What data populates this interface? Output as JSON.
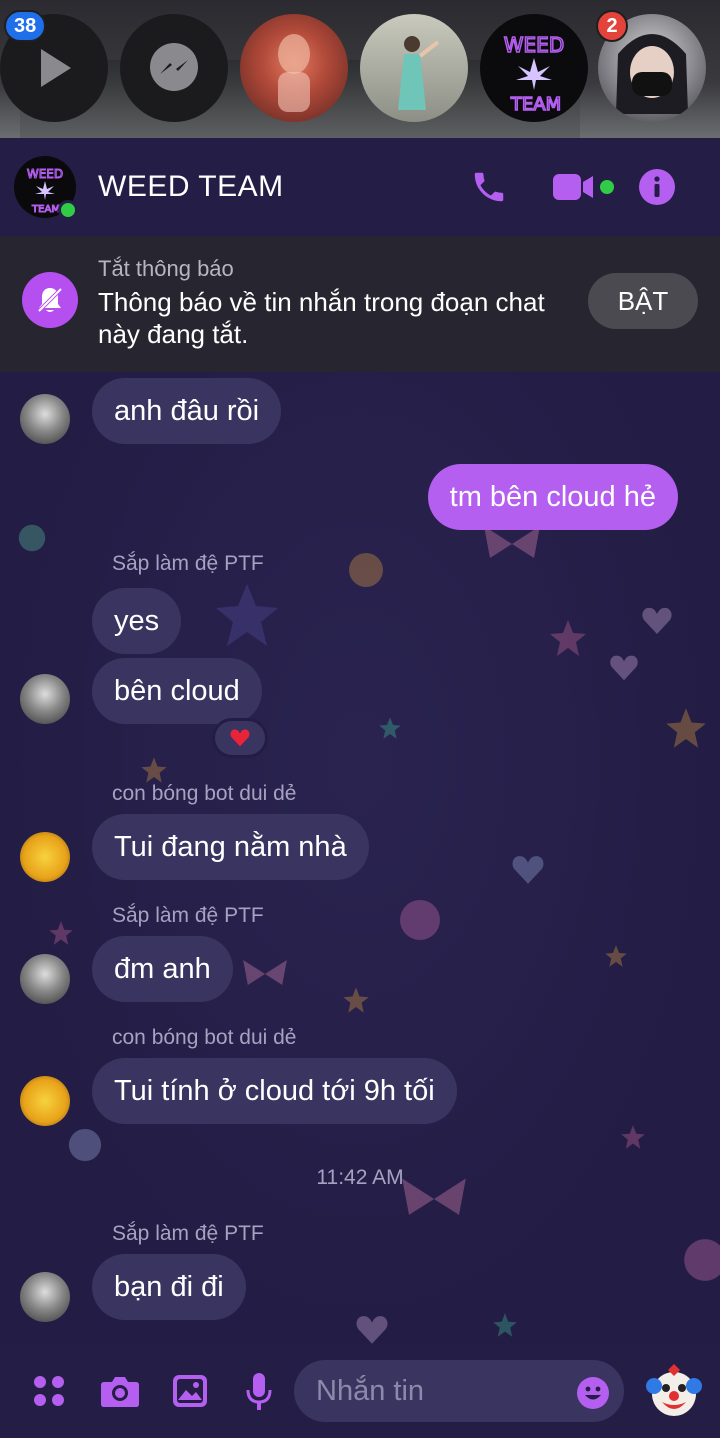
{
  "bubble_heads": {
    "badge_left": "38",
    "badge_right": "2"
  },
  "header": {
    "title": "WEED TEAM",
    "group_logo_text": "WEED TEAM"
  },
  "muted_banner": {
    "title": "Tắt thông báo",
    "text": "Thông báo về tin nhắn trong đoạn chat này đang tắt.",
    "button_label": "BẬT"
  },
  "messages": [
    {
      "sender": "",
      "text": "anh đâu rồi",
      "direction": "in"
    },
    {
      "sender": "",
      "text": "tm bên cloud hẻ",
      "direction": "out"
    },
    {
      "sender": "Sắp làm đệ PTF",
      "text": "yes",
      "direction": "in"
    },
    {
      "sender": "",
      "text": "bên cloud",
      "direction": "in",
      "reaction": "❤️"
    },
    {
      "sender": "con bóng bot dui dẻ",
      "text": "Tui đang nằm nhà",
      "direction": "in"
    },
    {
      "sender": "Sắp làm đệ PTF",
      "text": "đm anh",
      "direction": "in"
    },
    {
      "sender": "con bóng bot dui dẻ",
      "text": "Tui tính ở cloud tới 9h tối",
      "direction": "in"
    },
    {
      "sender": "Sắp làm đệ PTF",
      "text": "bạn đi đi",
      "direction": "in"
    }
  ],
  "timestamp": "11:42 AM",
  "composer": {
    "placeholder": "Nhắn tin"
  },
  "colors": {
    "accent": "#b45ff0",
    "background": "#231d45",
    "incoming_bubble": "#3a3460",
    "online": "#31cc46"
  },
  "icons": [
    "play-icon",
    "messenger-icon",
    "phone-icon",
    "video-icon",
    "info-icon",
    "bell-off-icon",
    "apps-icon",
    "camera-icon",
    "gallery-icon",
    "microphone-icon",
    "emoji-icon",
    "clown-emoji-icon"
  ]
}
